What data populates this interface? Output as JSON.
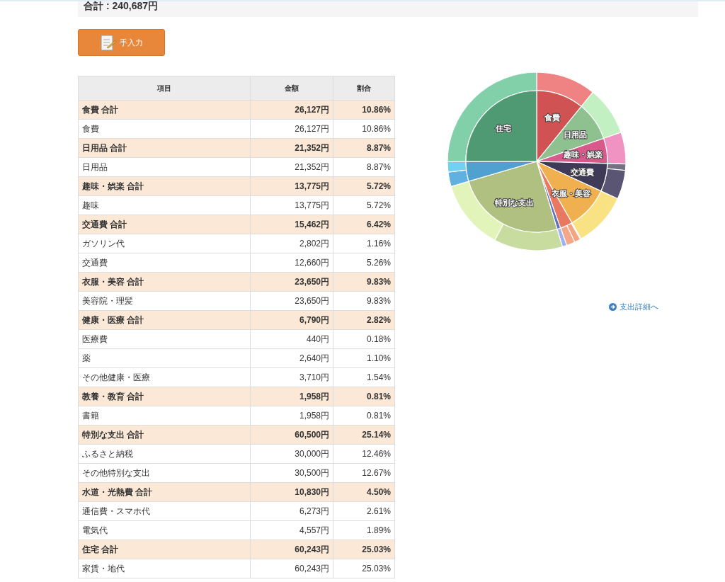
{
  "summary": {
    "total": "合計 : 240,687円"
  },
  "manual_button": {
    "label": "手入力"
  },
  "table": {
    "columns": [
      "項目",
      "金額",
      "割合"
    ],
    "groups": [
      {
        "name": "食費 合計",
        "amount": "26,127円",
        "share": "10.86%",
        "items": [
          {
            "name": "食費",
            "amount": "26,127円",
            "share": "10.86%"
          }
        ]
      },
      {
        "name": "日用品 合計",
        "amount": "21,352円",
        "share": "8.87%",
        "items": [
          {
            "name": "日用品",
            "amount": "21,352円",
            "share": "8.87%"
          }
        ]
      },
      {
        "name": "趣味・娯楽 合計",
        "amount": "13,775円",
        "share": "5.72%",
        "items": [
          {
            "name": "趣味",
            "amount": "13,775円",
            "share": "5.72%"
          }
        ]
      },
      {
        "name": "交通費 合計",
        "amount": "15,462円",
        "share": "6.42%",
        "items": [
          {
            "name": "ガソリン代",
            "amount": "2,802円",
            "share": "1.16%"
          },
          {
            "name": "交通費",
            "amount": "12,660円",
            "share": "5.26%"
          }
        ]
      },
      {
        "name": "衣服・美容 合計",
        "amount": "23,650円",
        "share": "9.83%",
        "items": [
          {
            "name": "美容院・理髪",
            "amount": "23,650円",
            "share": "9.83%"
          }
        ]
      },
      {
        "name": "健康・医療 合計",
        "amount": "6,790円",
        "share": "2.82%",
        "items": [
          {
            "name": "医療費",
            "amount": "440円",
            "share": "0.18%"
          },
          {
            "name": "薬",
            "amount": "2,640円",
            "share": "1.10%"
          },
          {
            "name": "その他健康・医療",
            "amount": "3,710円",
            "share": "1.54%"
          }
        ]
      },
      {
        "name": "教養・教育 合計",
        "amount": "1,958円",
        "share": "0.81%",
        "items": [
          {
            "name": "書籍",
            "amount": "1,958円",
            "share": "0.81%"
          }
        ]
      },
      {
        "name": "特別な支出 合計",
        "amount": "60,500円",
        "share": "25.14%",
        "items": [
          {
            "name": "ふるさと納税",
            "amount": "30,000円",
            "share": "12.46%"
          },
          {
            "name": "その他特別な支出",
            "amount": "30,500円",
            "share": "12.67%"
          }
        ]
      },
      {
        "name": "水道・光熱費 合計",
        "amount": "10,830円",
        "share": "4.50%",
        "items": [
          {
            "name": "通信費・スマホ代",
            "amount": "6,273円",
            "share": "2.61%"
          },
          {
            "name": "電気代",
            "amount": "4,557円",
            "share": "1.89%"
          }
        ]
      },
      {
        "name": "住宅 合計",
        "amount": "60,243円",
        "share": "25.03%",
        "items": [
          {
            "name": "家賃・地代",
            "amount": "60,243円",
            "share": "25.03%"
          }
        ]
      }
    ]
  },
  "pie_chart": {
    "slices": [
      {
        "label": "食費",
        "color": "#d05252",
        "items": [
          {
            "color": "#ef8282"
          }
        ]
      },
      {
        "label": "日用品",
        "color": "#8fc08f",
        "items": [
          {
            "color": "#c2f0c2"
          }
        ]
      },
      {
        "label": "趣味・娯楽",
        "color": "#d85a8a",
        "items": [
          {
            "color": "#f092c2"
          }
        ]
      },
      {
        "label": "交通費",
        "color": "#3e3a58",
        "items": [
          {
            "color": "#727282"
          },
          {
            "color": "#5a5572"
          }
        ]
      },
      {
        "label": "衣服・美容",
        "color": "#f0b050",
        "items": [
          {
            "color": "#f8e284"
          }
        ]
      },
      {
        "color": "#e87860",
        "items": [
          {
            "color": "#f0a080"
          },
          {
            "color": "#f2a484"
          },
          {
            "color": "#f4a888"
          }
        ]
      },
      {
        "color": "#6070c0",
        "items": [
          {
            "color": "#a0b0f0"
          }
        ]
      },
      {
        "label": "特別な支出",
        "color": "#b0c080",
        "items": [
          {
            "color": "#c8dca0"
          },
          {
            "color": "#e2f4ba"
          }
        ]
      },
      {
        "color": "#50a0d0",
        "items": [
          {
            "color": "#60b0e0"
          },
          {
            "color": "#72d0f2"
          }
        ]
      },
      {
        "label": "住宅",
        "color": "#4f9a72",
        "items": [
          {
            "color": "#82d0aa"
          }
        ]
      }
    ]
  },
  "detail_link": {
    "label": "支出詳細へ"
  }
}
